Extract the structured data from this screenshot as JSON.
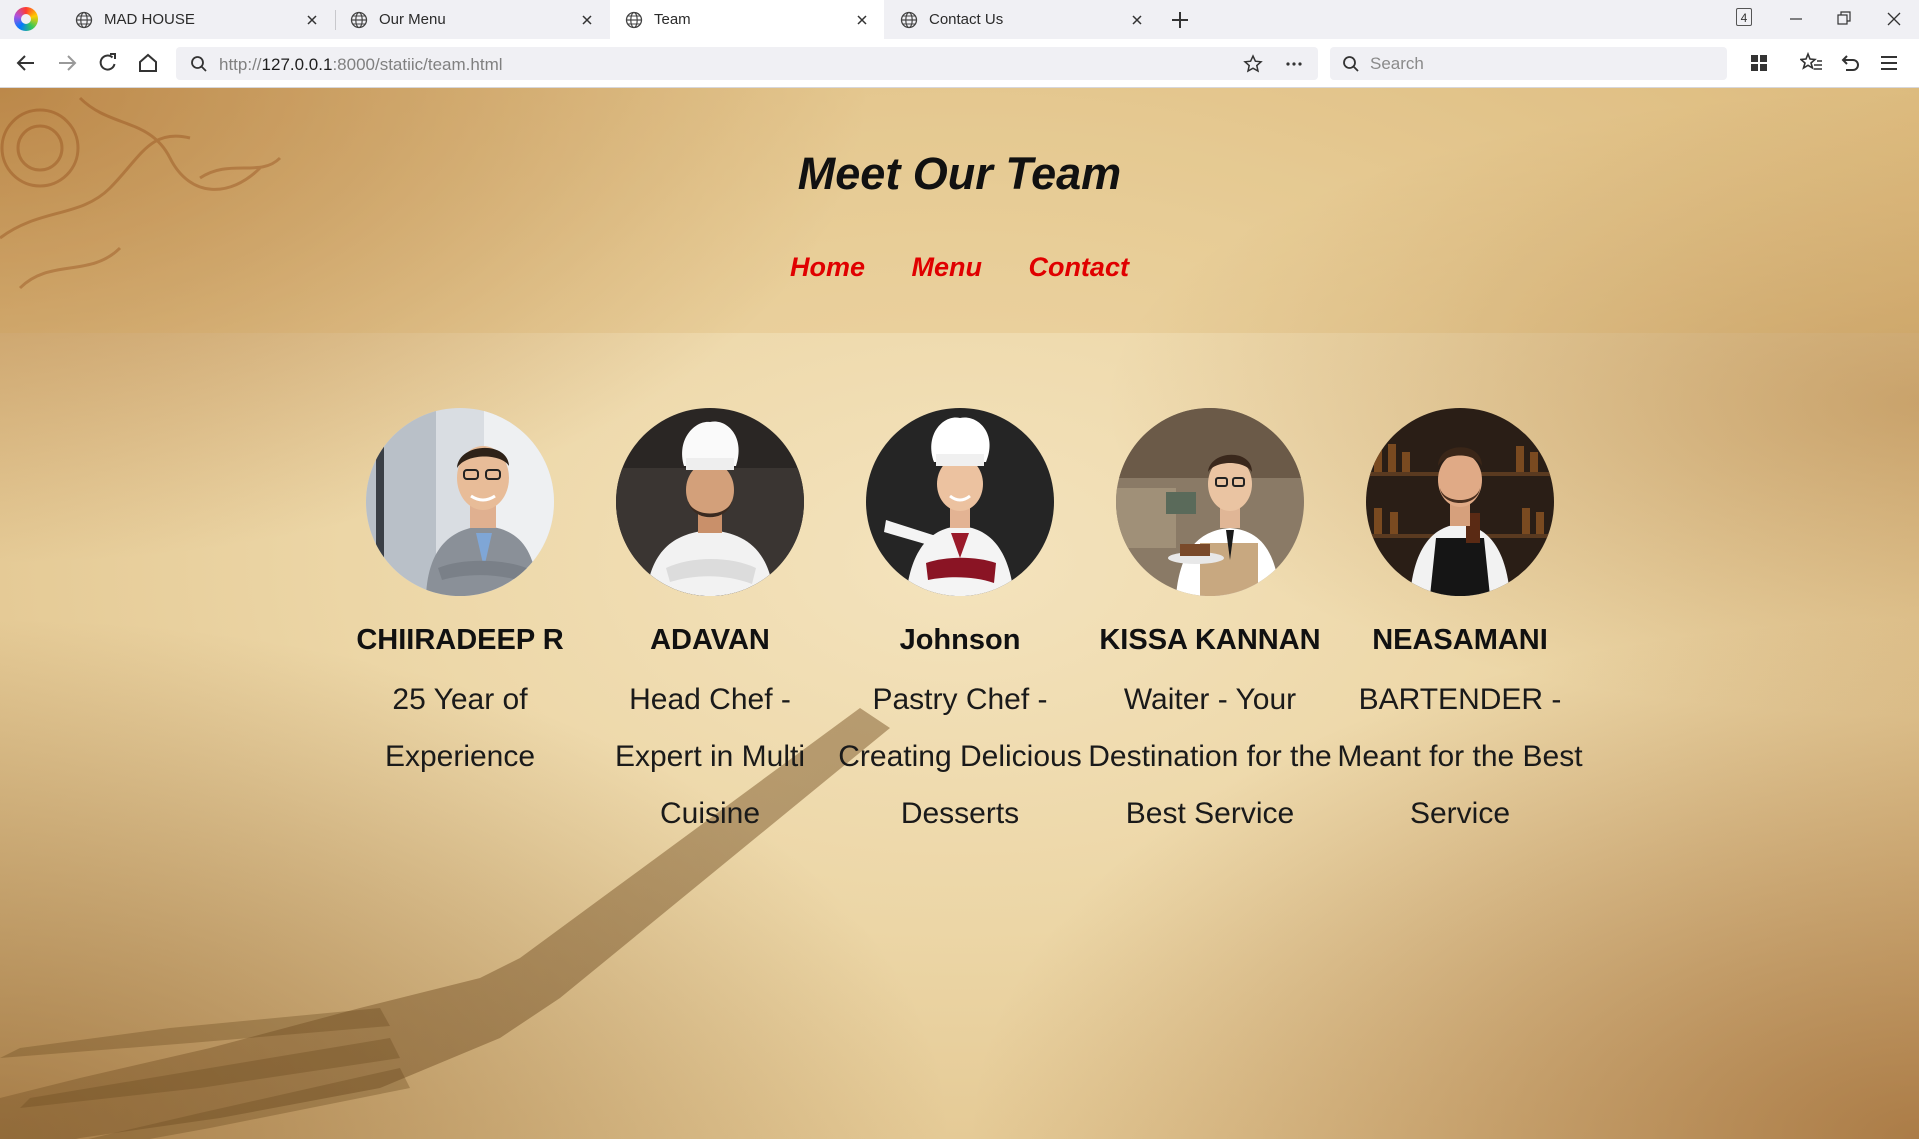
{
  "browser": {
    "tabs": [
      {
        "title": "MAD HOUSE",
        "active": false
      },
      {
        "title": "Our Menu",
        "active": false
      },
      {
        "title": "Team",
        "active": true
      },
      {
        "title": "Contact Us",
        "active": false
      }
    ],
    "tab_count": "4",
    "url": {
      "prefix": "http://",
      "host": "127.0.0.1",
      "rest": ":8000/statiic/team.html"
    },
    "search_placeholder": "Search"
  },
  "page": {
    "title": "Meet Our Team",
    "nav": [
      {
        "label": "Home"
      },
      {
        "label": "Menu"
      },
      {
        "label": "Contact"
      }
    ],
    "accent_color": "#e00000",
    "team": [
      {
        "name": "CHIIRADEEP R",
        "role": "25 Year of Experience",
        "photo": "businessman-photo"
      },
      {
        "name": "ADAVAN",
        "role": "Head Chef - Expert in Multi Cuisine",
        "photo": "chef-photo"
      },
      {
        "name": "Johnson",
        "role": "Pastry Chef - Creating Delicious Desserts",
        "photo": "pastry-chef-photo"
      },
      {
        "name": "KISSA KANNAN",
        "role": "Waiter - Your Destination for the Best Service",
        "photo": "waiter-photo"
      },
      {
        "name": "NEASAMANI",
        "role": "BARTENDER - Meant for the Best Service",
        "photo": "bartender-photo"
      }
    ]
  }
}
